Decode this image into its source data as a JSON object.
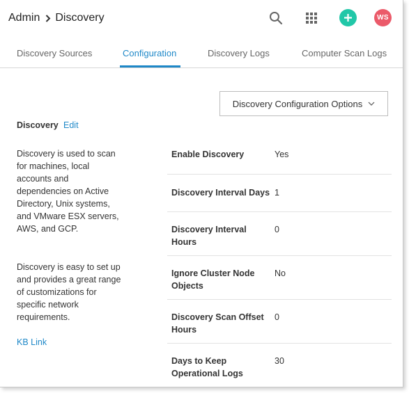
{
  "breadcrumb": {
    "parent": "Admin",
    "current": "Discovery"
  },
  "header": {
    "avatar_initials": "WS",
    "add_color": "#21c7a8",
    "avatar_color": "#eb5a6a"
  },
  "tabs": [
    {
      "label": "Discovery Sources",
      "active": false
    },
    {
      "label": "Configuration",
      "active": true
    },
    {
      "label": "Discovery Logs",
      "active": false
    },
    {
      "label": "Computer Scan Logs",
      "active": false
    }
  ],
  "options_button": {
    "label": "Discovery Configuration Options"
  },
  "section": {
    "title": "Discovery",
    "edit_label": "Edit",
    "description_1": "Discovery is used to scan for machines, local accounts and dependencies on Active Directory, Unix systems, and VMware ESX servers, AWS, and GCP.",
    "description_2": "Discovery is easy to set up and provides a great range of customizations for specific network requirements.",
    "kb_link": "KB Link"
  },
  "settings": [
    {
      "label": "Enable Discovery",
      "value": "Yes"
    },
    {
      "label": "Discovery Interval Days",
      "value": "1"
    },
    {
      "label": "Discovery Interval Hours",
      "value": "0"
    },
    {
      "label": "Ignore Cluster Node Objects",
      "value": "No"
    },
    {
      "label": "Discovery Scan Offset Hours",
      "value": "0"
    },
    {
      "label": "Days to Keep Operational Logs",
      "value": "30"
    }
  ],
  "accent_color": "#1e88c8"
}
